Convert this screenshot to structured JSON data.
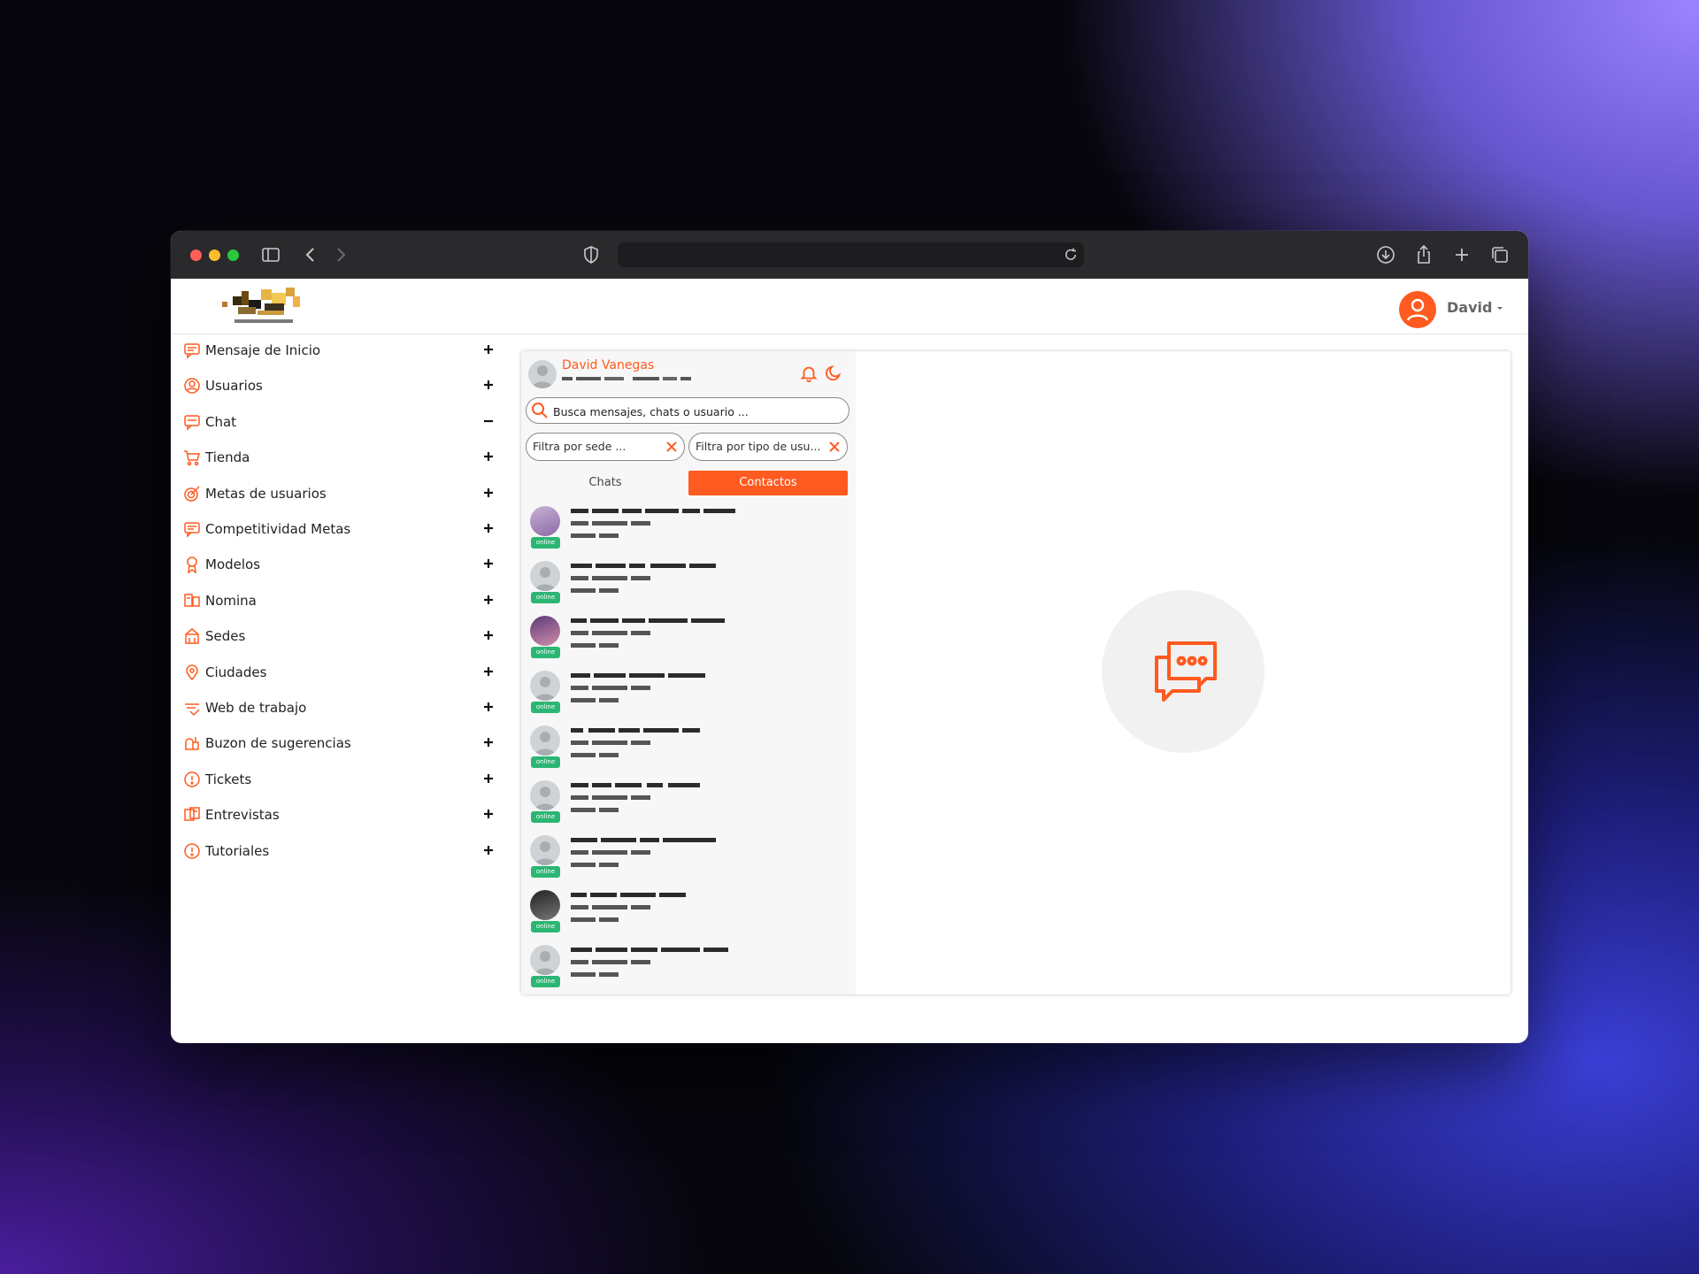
{
  "browser": {
    "dots": [
      "#ff5f57",
      "#febc2e",
      "#28c840"
    ]
  },
  "header": {
    "user_name": "David"
  },
  "sidebar": {
    "items": [
      {
        "label": "Mensaje de Inicio",
        "icon": "message-square-icon",
        "toggle": "+"
      },
      {
        "label": "Usuarios",
        "icon": "user-circle-icon",
        "toggle": "+"
      },
      {
        "label": "Chat",
        "icon": "chat-bubble-icon",
        "toggle": "−"
      },
      {
        "label": "Tienda",
        "icon": "shopping-cart-icon",
        "toggle": "+"
      },
      {
        "label": "Metas de usuarios",
        "icon": "target-icon",
        "toggle": "+"
      },
      {
        "label": "Competitividad Metas",
        "icon": "message-square-icon",
        "toggle": "+"
      },
      {
        "label": "Modelos",
        "icon": "medal-icon",
        "toggle": "+"
      },
      {
        "label": "Nomina",
        "icon": "payroll-icon",
        "toggle": "+"
      },
      {
        "label": "Sedes",
        "icon": "building-icon",
        "toggle": "+"
      },
      {
        "label": "Ciudades",
        "icon": "map-pin-icon",
        "toggle": "+"
      },
      {
        "label": "Web de trabajo",
        "icon": "web-icon",
        "toggle": "+"
      },
      {
        "label": "Buzon de sugerencias",
        "icon": "mailbox-icon",
        "toggle": "+"
      },
      {
        "label": "Tickets",
        "icon": "alert-circle-icon",
        "toggle": "+"
      },
      {
        "label": "Entrevistas",
        "icon": "interview-icon",
        "toggle": "+"
      },
      {
        "label": "Tutoriales",
        "icon": "alert-circle-icon",
        "toggle": "+"
      }
    ]
  },
  "chat": {
    "me": {
      "name": "David Vanegas"
    },
    "search_placeholder": "Busca mensajes, chats o usuario ...",
    "filters": [
      "Filtra por sede ...",
      "Filtra por tipo de usu..."
    ],
    "tabs": [
      "Chats",
      "Contactos"
    ],
    "active_tab": "Contactos",
    "online_label": "online",
    "contact_count": 9
  },
  "colors": {
    "accent": "#ff5a1f",
    "online": "#2bb673"
  }
}
